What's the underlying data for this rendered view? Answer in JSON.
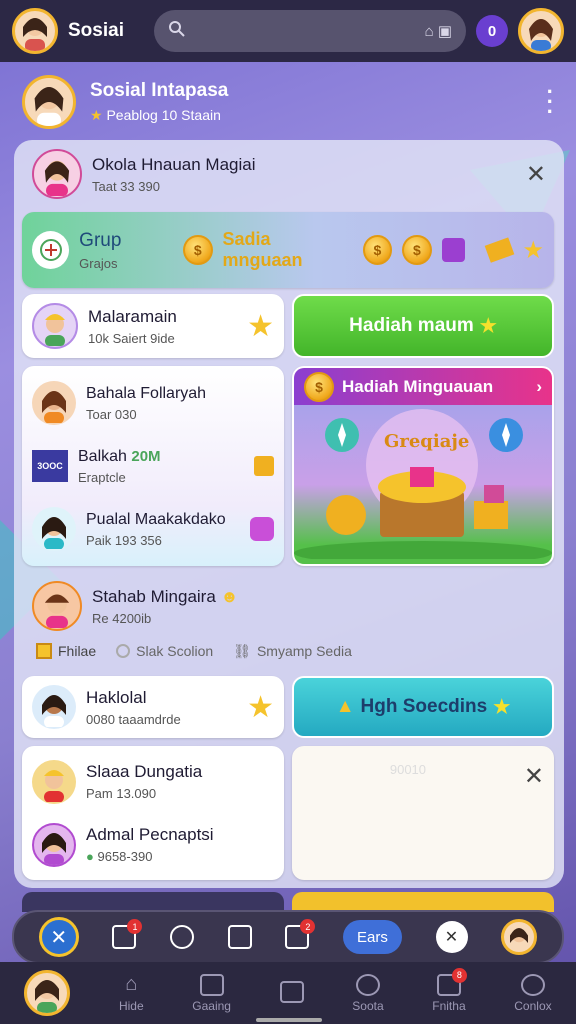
{
  "topbar": {
    "brand": "Sosiai",
    "search_placeholder": "",
    "search_suffix": "⌂ ▣",
    "profile_badge": "0"
  },
  "profile": {
    "name": "Sosial Intapasa",
    "sub": "Peablog 10 Staain"
  },
  "notice": {
    "title": "Okola Hnauan Magiai",
    "sub": "Taat 33 390"
  },
  "group_banner": {
    "title": "Grup",
    "sub": "Grajos",
    "promo": "Sadia mnguaan"
  },
  "row1": {
    "name": "Malaramain",
    "sub": "10k Saiert 9ide",
    "button": "Hadiah maum"
  },
  "friends": [
    {
      "name": "Bahala Follaryah",
      "sub": "Toar 030"
    },
    {
      "name": "Balkah",
      "sub": "Eraptcle",
      "amount": "20M",
      "logo": "3OOC"
    },
    {
      "name": "Pualal Maakakdako",
      "sub": "Paik 193 356"
    }
  ],
  "reward_card": {
    "title": "Hadiah Minguauan",
    "art_label": "Greqiaje"
  },
  "section": {
    "title": "Stahab Mingaira",
    "sub": "Re 4200ib",
    "chips": [
      "Fhilae",
      "Slak Scolion",
      "Smyamp Sedia"
    ]
  },
  "row2": {
    "name": "Haklolal",
    "sub": "0080 taaamdrde",
    "button": "Hgh Soecdins"
  },
  "row3": [
    {
      "name": "Slaaa Dungatia",
      "sub": "Pam 13.090"
    },
    {
      "name": "Admal Pecnaptsi",
      "sub": "9658-390"
    }
  ],
  "empty_card": {
    "label": "90010"
  },
  "toolbar": {
    "pill_label": "Ears",
    "badge_a": "1",
    "badge_b": "2"
  },
  "nav": [
    {
      "label": "Hide"
    },
    {
      "label": "Gaaing"
    },
    {
      "label": ""
    },
    {
      "label": "Soota"
    },
    {
      "label": "Fnitha",
      "badge": "8"
    },
    {
      "label": "Conlox"
    }
  ],
  "colors": {
    "green": "#5cc63a",
    "teal": "#2bb9c7",
    "pink": "#e8338a",
    "gold": "#f2b52f",
    "dark": "#2c2845"
  }
}
